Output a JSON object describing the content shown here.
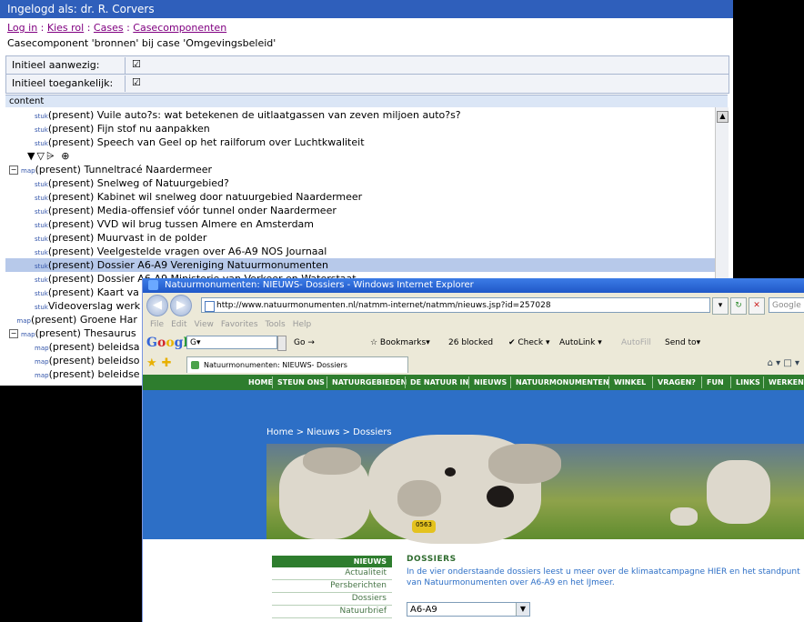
{
  "cms": {
    "title": "Ingelogd als: dr. R. Corvers",
    "crumbs": [
      "Log in",
      "Kies rol",
      "Cases",
      "Casecomponenten"
    ],
    "crumb_sep": " : ",
    "description": "Casecomponent 'bronnen' bij case 'Omgevingsbeleid'",
    "props": [
      {
        "label": "Initieel aanwezig:",
        "value": "☑"
      },
      {
        "label": "Initieel toegankelijk:",
        "value": "☑"
      }
    ],
    "content_header": "content",
    "tools": "▼▽⩥ ⊕",
    "tree": [
      {
        "tag": "stuk",
        "text": "(present) Vuile auto?s: wat betekenen de uitlaatgassen van zeven miljoen auto?s?",
        "indent": 1
      },
      {
        "tag": "stuk",
        "text": "(present) Fijn stof nu aanpakken",
        "indent": 1
      },
      {
        "tag": "stuk",
        "text": "(present) Speech van Geel op het railforum over Luchtkwaliteit",
        "indent": 1
      },
      {
        "tag": "map",
        "text": "(present) Tunneltracé Naardermeer",
        "indent": 0,
        "expander": "−"
      },
      {
        "tag": "stuk",
        "text": "(present) Snelweg of Natuurgebied?",
        "indent": 1
      },
      {
        "tag": "stuk",
        "text": "(present) Kabinet wil snelweg door natuurgebied Naardermeer",
        "indent": 1
      },
      {
        "tag": "stuk",
        "text": "(present) Media-offensief vóór tunnel onder Naardermeer",
        "indent": 1
      },
      {
        "tag": "stuk",
        "text": "(present) VVD wil brug tussen Almere en Amsterdam",
        "indent": 1
      },
      {
        "tag": "stuk",
        "text": "(present) Muurvast in de polder",
        "indent": 1
      },
      {
        "tag": "stuk",
        "text": "(present) Veelgestelde vragen over A6-A9 NOS Journaal",
        "indent": 1
      },
      {
        "tag": "stuk",
        "text": "(present) Dossier A6-A9 Vereniging Natuurmonumenten",
        "indent": 1,
        "selected": true
      },
      {
        "tag": "stuk",
        "text": "(present) Dossier A6-A9 Ministerie van Verkeer en Waterstaat",
        "indent": 1
      },
      {
        "tag": "stuk",
        "text": "(present) Kaart va",
        "indent": 1
      },
      {
        "tag": "stuk",
        "text": "Videoverslag werk",
        "indent": 1
      },
      {
        "tag": "map",
        "text": "(present) Groene Har",
        "indent": 0.3
      },
      {
        "tag": "map",
        "text": "(present) Thesaurus",
        "indent": 0,
        "expander": "−"
      },
      {
        "tag": "map",
        "text": "(present) beleidsa",
        "indent": 1
      },
      {
        "tag": "map",
        "text": "(present) beleidso",
        "indent": 1
      },
      {
        "tag": "map",
        "text": "(present) beleidse",
        "indent": 1
      }
    ]
  },
  "ie": {
    "title": "Natuurmonumenten: NIEUWS- Dossiers - Windows Internet Explorer",
    "address": "http://www.natuurmonumenten.nl/natmm-internet/natmm/nieuws.jsp?id=257028",
    "search_placeholder": "Google",
    "menu": [
      "File",
      "Edit",
      "View",
      "Favorites",
      "Tools",
      "Help"
    ],
    "google_logo": "Google",
    "google_box": "G▾",
    "google_items": [
      "Go →",
      "☆ Bookmarks▾",
      "26 blocked",
      "✔ Check ▾",
      "AutoLink ▾",
      "AutoFill",
      "Send to▾"
    ],
    "tab_label": "Natuurmonumenten: NIEUWS- Dossiers",
    "tab_tools": "⌂ ▾ □ ▾",
    "nav": [
      "HOME",
      "STEUN ONS",
      "NATUURGEBIEDEN",
      "DE NATUUR IN",
      "NIEUWS",
      "NATUURMONUMENTEN",
      "WINKEL",
      "VRAGEN?",
      "FUN",
      "LINKS",
      "WERKEN"
    ],
    "breadcrumb": "Home > Nieuws > Dossiers",
    "ear_tag": "0563",
    "side_header": "NIEUWS",
    "side_items": [
      "Actualiteit",
      "Persberichten",
      "Dossiers",
      "Natuurbrief"
    ],
    "heading": "DOSSIERS",
    "intro": "In de vier onderstaande dossiers leest u meer over de klimaatcampagne HIER en het standpunt van Natuurmonumenten over A6-A9 en het IJmeer.",
    "select_value": "A6-A9"
  },
  "colors": {
    "accent_blue": "#2f5fbb",
    "green": "#2e7d2e",
    "site_blue": "#2d6fc6"
  }
}
